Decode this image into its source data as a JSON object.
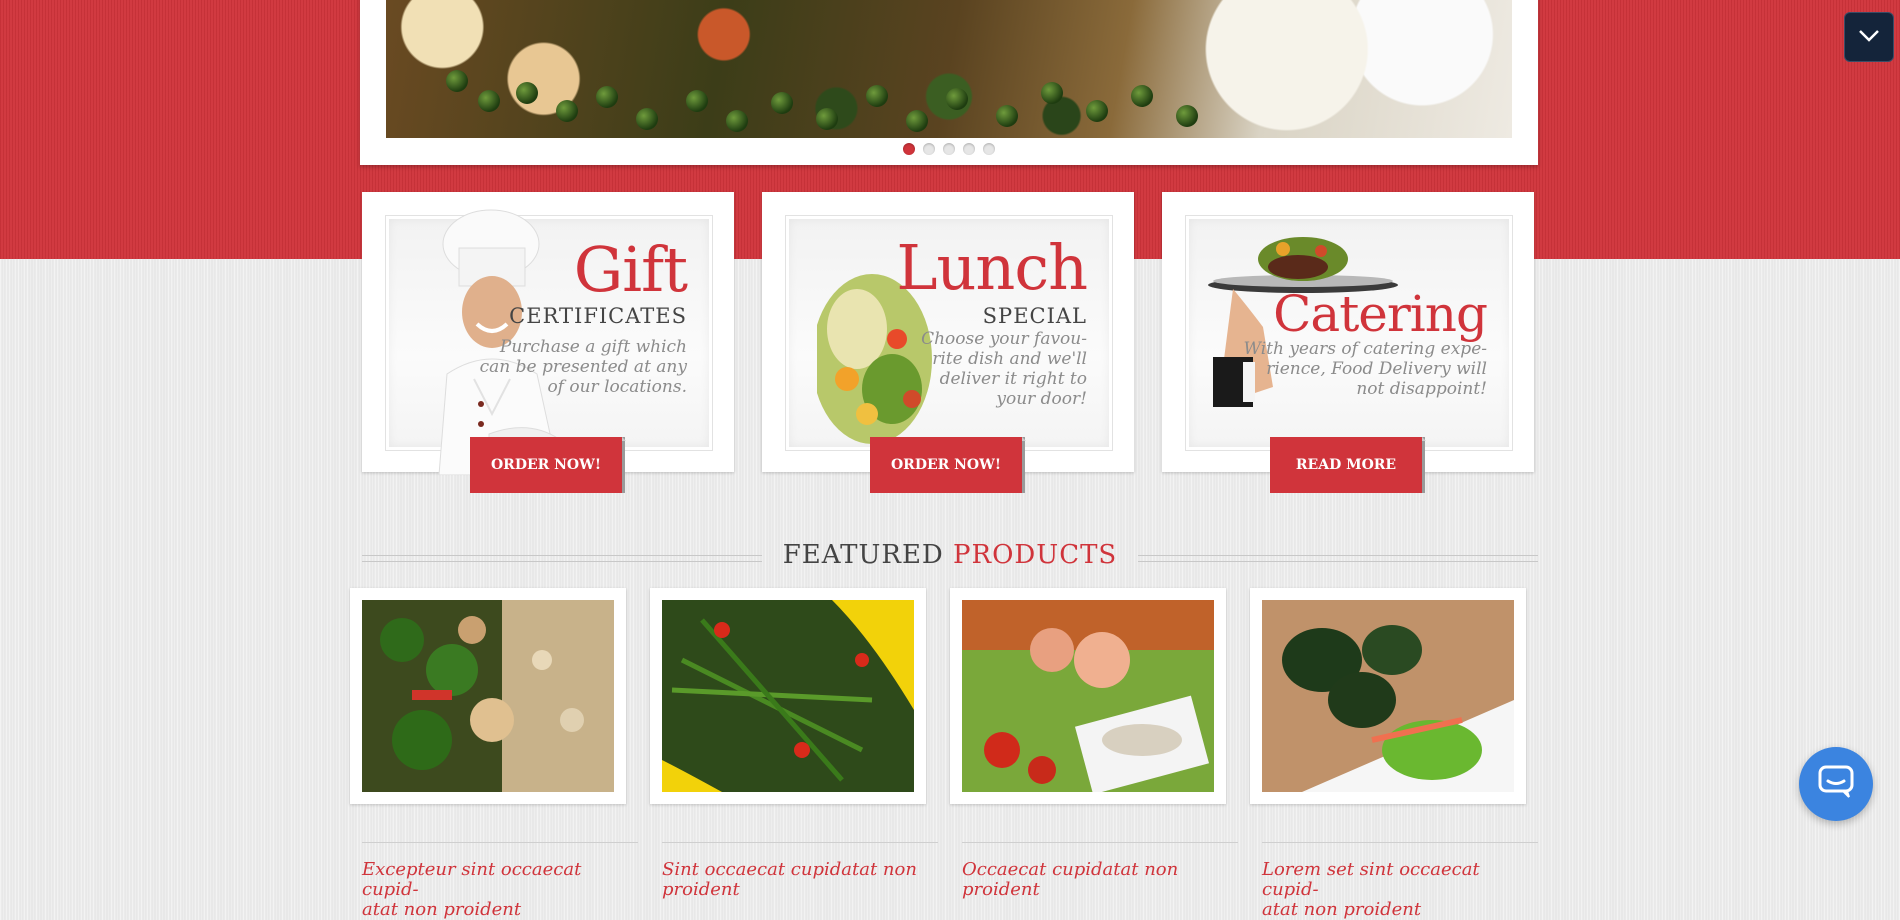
{
  "slider": {
    "slides": [
      "slide-1",
      "slide-2",
      "slide-3",
      "slide-4",
      "slide-5"
    ],
    "active_index": 0
  },
  "promos": [
    {
      "title": "Gift",
      "subtitle": "CERTIFICATES",
      "text_lines": [
        "Purchase a gift which",
        "can be presented at any",
        "of our locations."
      ],
      "button": "ORDER NOW!"
    },
    {
      "title": "Lunch",
      "subtitle": "SPECIAL",
      "text_lines": [
        "Choose your favou-",
        "rite dish and we'll",
        "deliver it right to",
        "your door!"
      ],
      "button": "ORDER NOW!"
    },
    {
      "title": "Catering",
      "subtitle": "",
      "text_lines": [
        "With years of catering expe-",
        "rience, Food Delivery will",
        "not disappoint!"
      ],
      "button": "READ MORE"
    }
  ],
  "featured": {
    "title_main": "FEATURED",
    "title_accent": "PRODUCTS"
  },
  "products": [
    {
      "name_lines": [
        "Excepteur sint occaecat cupid-",
        "atat non proident"
      ]
    },
    {
      "name_lines": [
        "Sint occaecat cupidatat non",
        "proident"
      ]
    },
    {
      "name_lines": [
        "Occaecat cupidatat non proident"
      ]
    },
    {
      "name_lines": [
        "Lorem set sint occaecat cupid-",
        "atat non proident"
      ]
    }
  ],
  "colors": {
    "brand_red": "#d0343b",
    "chat_blue": "#3b84e0",
    "toggle_navy": "#14243a"
  },
  "icons": {
    "toggle": "chevron-down-icon",
    "chat": "chat-bubble-icon"
  }
}
